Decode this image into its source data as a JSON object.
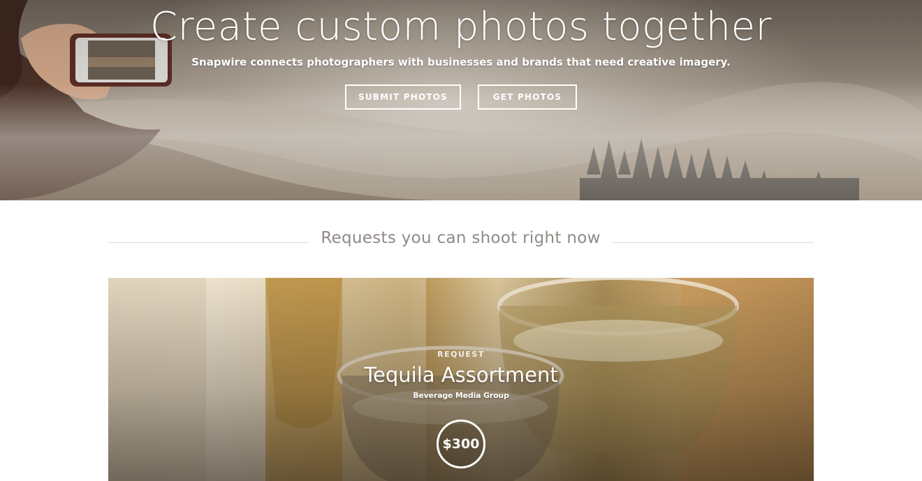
{
  "hero": {
    "title": "Create custom photos together",
    "subtitle": "Snapwire connects photographers with businesses and brands that need creative imagery.",
    "buttons": {
      "submit_label": "SUBMIT PHOTOS",
      "get_label": "GET PHOTOS"
    }
  },
  "requests_section": {
    "heading": "Requests you can shoot right now"
  },
  "request_card": {
    "label": "REQUEST",
    "title": "Tequila Assortment",
    "company": "Beverage Media Group",
    "price": "$300"
  },
  "colors": {
    "text_white": "#ffffff",
    "heading_gray": "#8f8a86",
    "rule_gray": "#dcdcdc"
  }
}
